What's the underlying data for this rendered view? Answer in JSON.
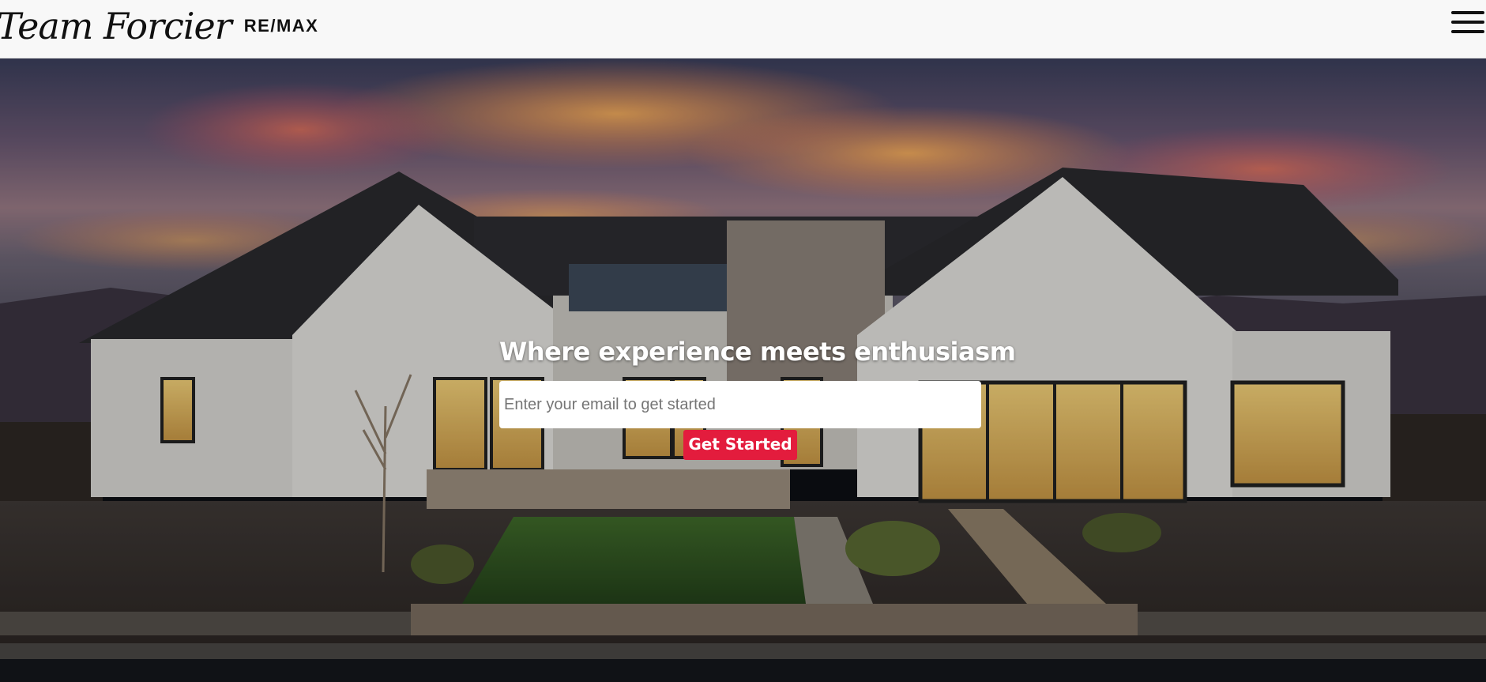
{
  "header": {
    "logo_script": "Team Forcier",
    "logo_brand": "RE/MAX",
    "menu_icon": "hamburger-menu-icon"
  },
  "hero": {
    "background_description_icon": "house-photo",
    "title": "Where experience meets enthusiasm",
    "email_placeholder": "Enter your email to get started",
    "email_value": "",
    "cta_label": "Get Started"
  },
  "colors": {
    "header_bg": "#f8f8f8",
    "accent": "#e31c3d",
    "text_dark": "#111111",
    "text_light": "#ffffff"
  }
}
